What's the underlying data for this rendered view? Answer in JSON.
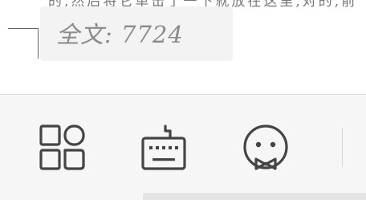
{
  "editor": {
    "clipped_text": "的,然后将它单击了一下就放在这里,对的,前",
    "word_count_label": "全文: 7724"
  },
  "toolbar": {
    "tools": [
      {
        "name": "more-apps",
        "icon": "grid-icon"
      },
      {
        "name": "keyboard",
        "icon": "keyboard-icon"
      },
      {
        "name": "emoji",
        "icon": "emoji-icon"
      }
    ]
  },
  "colors": {
    "icon": "#444444",
    "toolbar_bg": "#f6f6f6",
    "count_box_bg": "#f3f3f3"
  }
}
